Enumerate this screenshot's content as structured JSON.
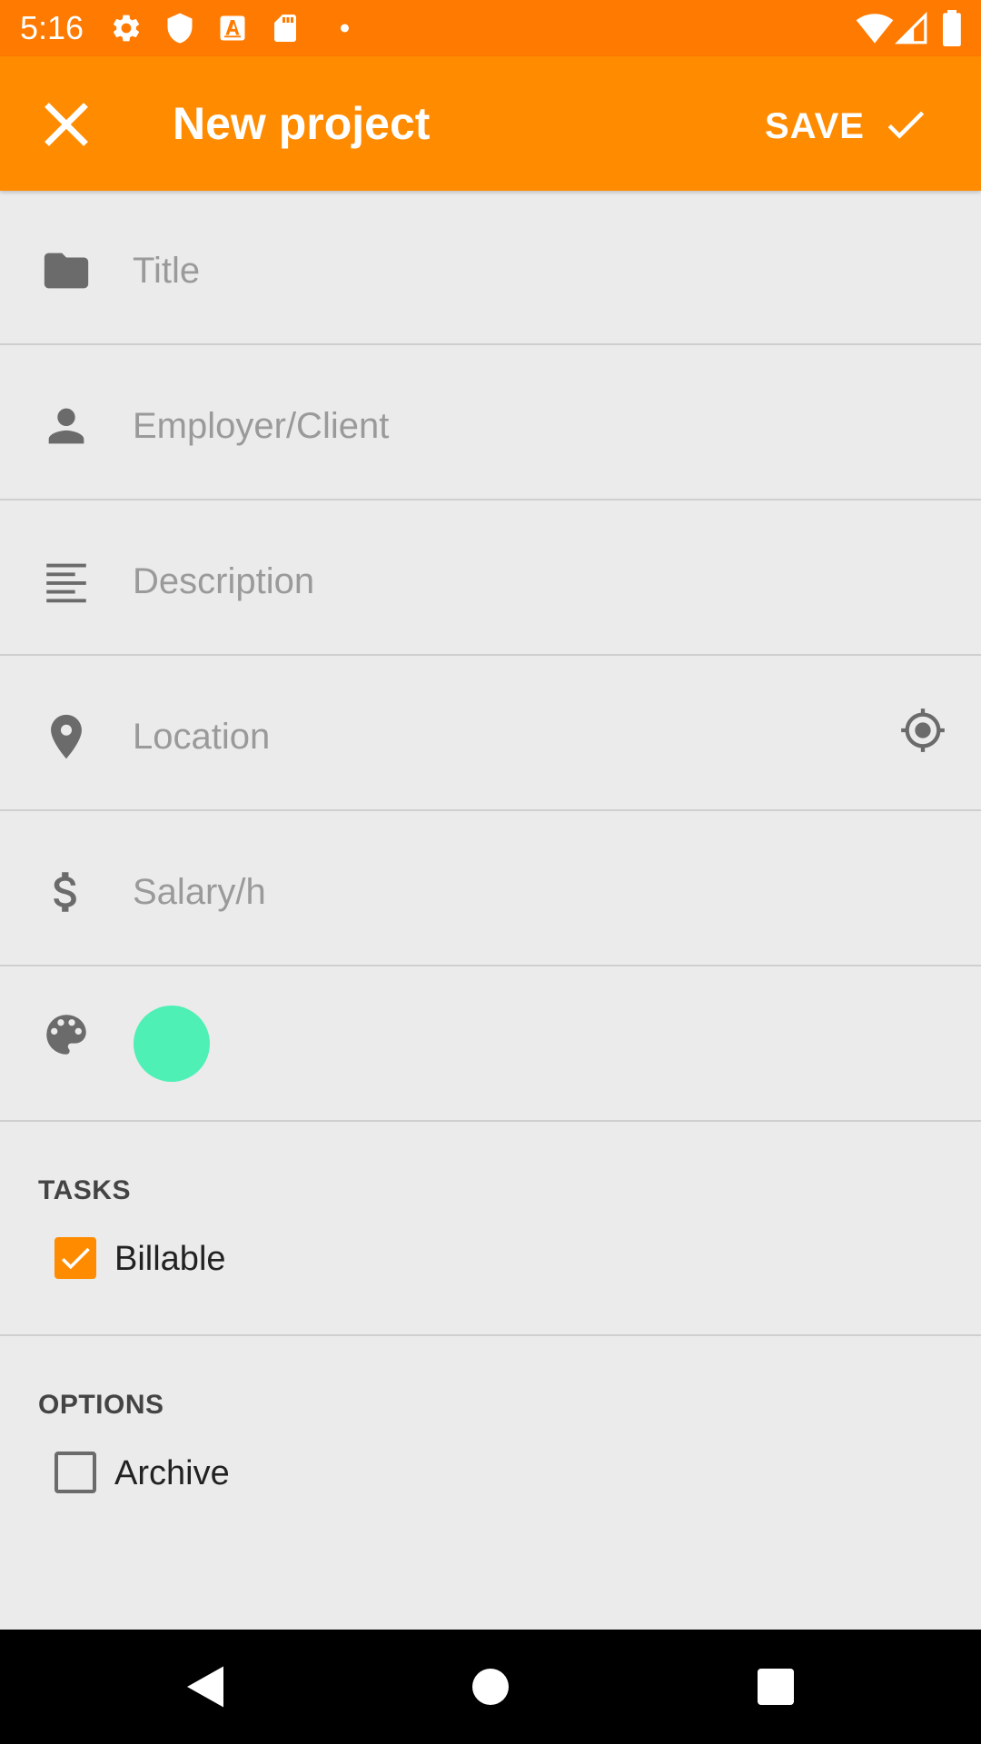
{
  "status_bar": {
    "time": "5:16",
    "left_icons": [
      "gear-icon",
      "shield-icon",
      "font-icon",
      "sd-card-icon",
      "dot-icon"
    ],
    "right_icons": [
      "wifi-icon",
      "signal-icon",
      "battery-icon"
    ]
  },
  "app_bar": {
    "title": "New project",
    "close_icon": "close-icon",
    "save_label": "SAVE",
    "save_icon": "check-icon"
  },
  "form": {
    "title": {
      "placeholder": "Title",
      "value": "",
      "icon": "folder-icon"
    },
    "client": {
      "placeholder": "Employer/Client",
      "value": "",
      "icon": "person-icon"
    },
    "description": {
      "placeholder": "Description",
      "value": "",
      "icon": "notes-icon"
    },
    "location": {
      "placeholder": "Location",
      "value": "",
      "icon": "location-pin-icon",
      "action_icon": "my-location-icon"
    },
    "salary": {
      "placeholder": "Salary/h",
      "value": "",
      "icon": "dollar-icon"
    },
    "color": {
      "icon": "palette-icon",
      "value": "#4ef0b6"
    }
  },
  "tasks": {
    "heading": "TASKS",
    "billable": {
      "label": "Billable",
      "checked": true
    }
  },
  "options": {
    "heading": "OPTIONS",
    "archive": {
      "label": "Archive",
      "checked": false
    }
  },
  "nav_bar": {
    "icons": [
      "back-icon",
      "home-icon",
      "recents-icon"
    ]
  },
  "colors": {
    "status_bar": "#ff7a00",
    "app_bar": "#ff8b00",
    "accent": "#ff8b00",
    "background": "#ebebeb",
    "icon_gray": "#6b6b6b"
  }
}
